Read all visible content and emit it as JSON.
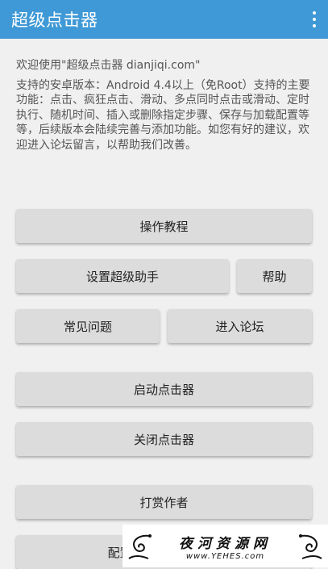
{
  "appbar": {
    "title": "超级点击器",
    "menu_icon": "overflow-menu-icon"
  },
  "intro": {
    "line1": "欢迎使用\"超级点击器 dianjiqi.com\"",
    "paragraph": "支持的安卓版本：Android 4.4以上（免Root）支持的主要功能：点击、疯狂点击、滑动、多点同时点击或滑动、定时执行、随机时间、插入或删除指定步骤、保存与加载配置等等，后续版本会陆续完善与添加功能。如您有好的建议，欢迎进入论坛留言，以帮助我们改善。"
  },
  "buttons": {
    "tutorial": "操作教程",
    "setup_assistant": "设置超级助手",
    "help": "帮助",
    "faq": "常见问题",
    "forum": "进入论坛",
    "start_clicker": "启动点击器",
    "stop_clicker": "关闭点击器",
    "tip_author": "打赏作者",
    "config_manage": "配置管理 | 存储/加载"
  },
  "watermark": {
    "cn": "夜河资源网",
    "url": "www.YEHES.com"
  },
  "colors": {
    "appbar": "#3f99d6",
    "background": "#f0f0f0",
    "button": "#dcdcdc",
    "intro_text": "#555555"
  }
}
